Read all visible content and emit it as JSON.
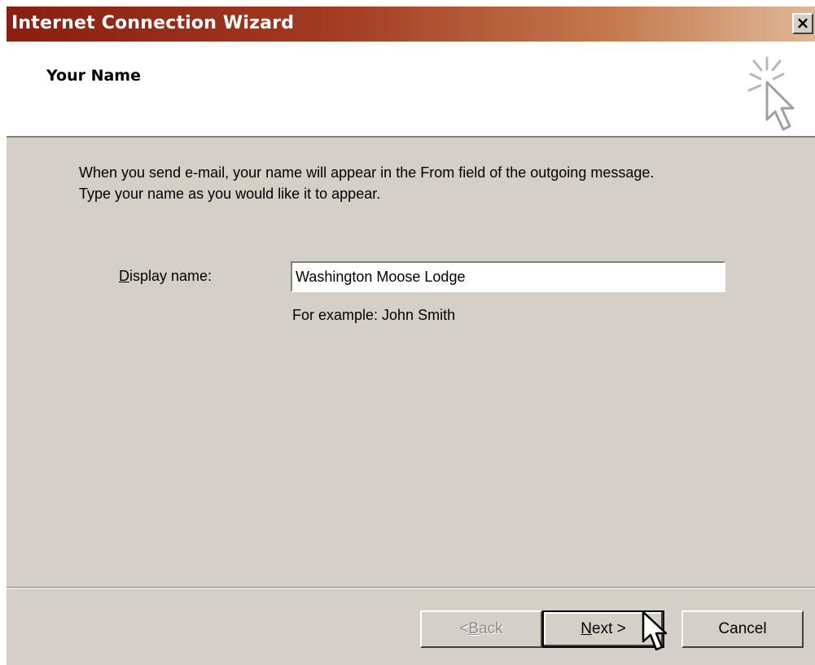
{
  "window": {
    "title": "Internet Connection Wizard",
    "close_label": "×"
  },
  "header": {
    "title": "Your Name",
    "icon": "wizard-pointer-icon"
  },
  "content": {
    "description_line1": "When you send e-mail, your name will appear in the From field of the outgoing message.",
    "description_line2": "Type your name as you would like it to appear.",
    "field_label_accel": "D",
    "field_label_rest": "isplay name:",
    "display_name_value": "Washington Moose Lodge",
    "example_text": "For example: John Smith"
  },
  "buttons": {
    "back_prefix": "< ",
    "back_accel": "B",
    "back_rest": "ack",
    "next_accel": "N",
    "next_rest": "ext >",
    "cancel": "Cancel"
  },
  "colors": {
    "titlebar_start": "#8a1e10",
    "titlebar_end": "#dfb898",
    "dialog_bg": "#d4d0c8"
  }
}
